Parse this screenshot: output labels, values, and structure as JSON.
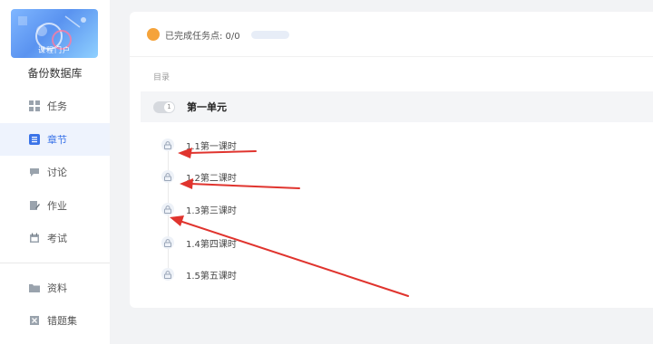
{
  "sidebar": {
    "course_thumb_label": "课程门户",
    "course_name": "备份数据库",
    "items": [
      {
        "label": "任务",
        "icon": "grid-icon"
      },
      {
        "label": "章节",
        "icon": "list-icon",
        "active": true
      },
      {
        "label": "讨论",
        "icon": "chat-icon"
      },
      {
        "label": "作业",
        "icon": "edit-icon"
      },
      {
        "label": "考试",
        "icon": "calendar-icon"
      },
      {
        "label": "资料",
        "icon": "folder-icon"
      },
      {
        "label": "错题集",
        "icon": "book-icon"
      }
    ]
  },
  "progress": {
    "text": "已完成任务点: 0/0",
    "completed_fraction": 0
  },
  "toc": {
    "label": "目录",
    "unit": {
      "number": "1",
      "title": "第一单元"
    },
    "lessons": [
      {
        "title": "1.1第一课时",
        "locked": true
      },
      {
        "title": "1.2第二课时",
        "locked": true
      },
      {
        "title": "1.3第三课时",
        "locked": true
      },
      {
        "title": "1.4第四课时",
        "locked": true
      },
      {
        "title": "1.5第五课时",
        "locked": true
      }
    ]
  },
  "colors": {
    "accent": "#3a73e8",
    "active_bg": "#eef3fd",
    "progress_dot": "#f5a33a",
    "annotation_arrow": "#e0342e"
  }
}
